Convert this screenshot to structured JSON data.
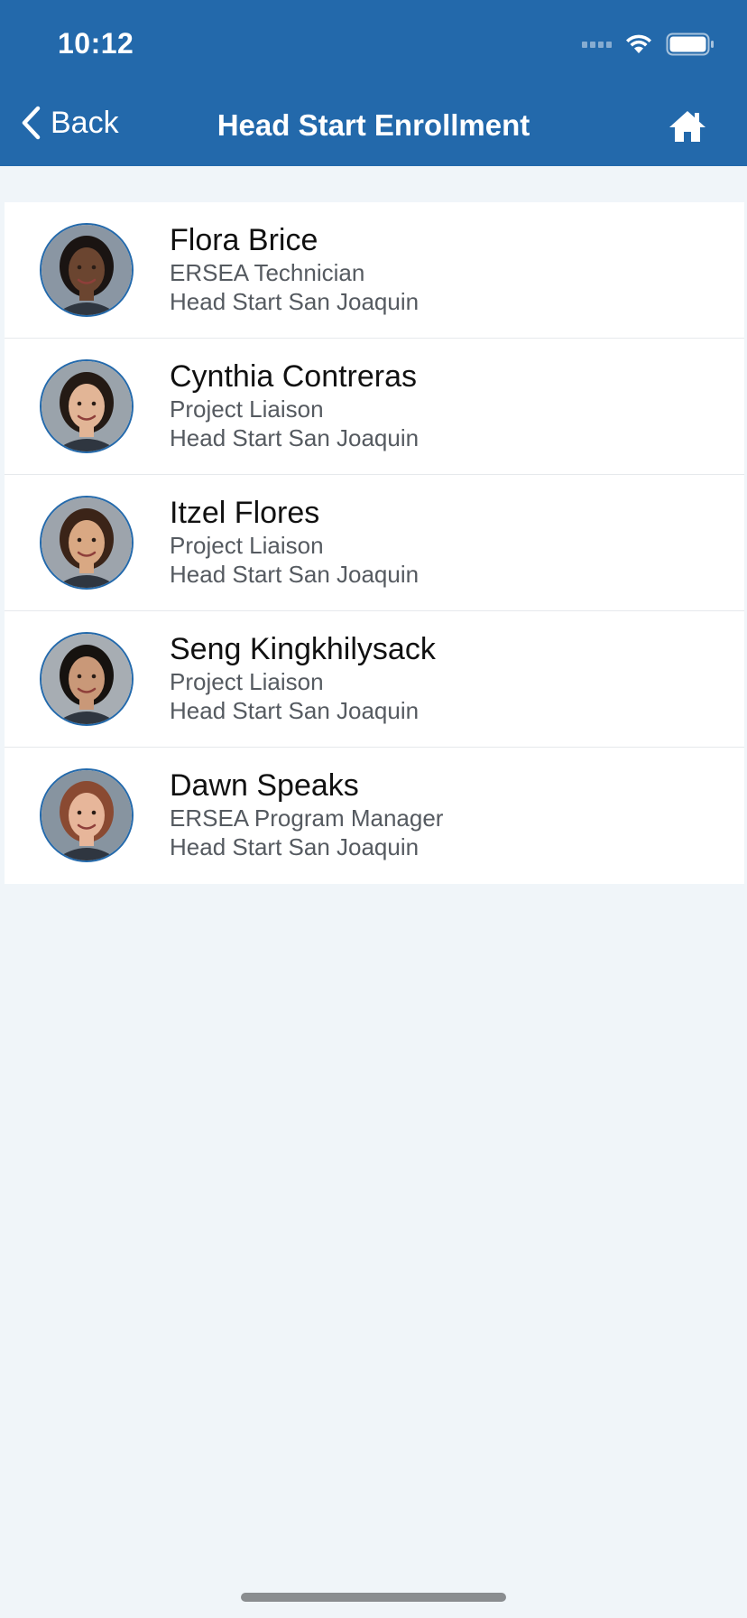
{
  "status_bar": {
    "time": "10:12"
  },
  "nav": {
    "back_label": "Back",
    "title": "Head Start Enrollment",
    "home_icon": "home-icon"
  },
  "colors": {
    "header": "#2369ab",
    "background": "#f0f5f9",
    "avatar_border": "#2369ab"
  },
  "contacts": [
    {
      "name": "Flora Brice",
      "role": "ERSEA Technician",
      "org": "Head Start San Joaquin",
      "skin": "#6b4530",
      "hair": "#1a1412",
      "bg": "#8a96a3"
    },
    {
      "name": "Cynthia Contreras",
      "role": "Project Liaison",
      "org": "Head Start San Joaquin",
      "skin": "#e2b596",
      "hair": "#241a14",
      "bg": "#9aa3ab"
    },
    {
      "name": "Itzel Flores",
      "role": "Project Liaison",
      "org": "Head Start San Joaquin",
      "skin": "#d9a883",
      "hair": "#3b2418",
      "bg": "#9da4ac"
    },
    {
      "name": "Seng Kingkhilysack",
      "role": "Project Liaison",
      "org": "Head Start San Joaquin",
      "skin": "#c99878",
      "hair": "#16120f",
      "bg": "#a7adb3"
    },
    {
      "name": "Dawn Speaks",
      "role": "ERSEA Program Manager",
      "org": "Head Start San Joaquin",
      "skin": "#e7b69a",
      "hair": "#8a4a32",
      "bg": "#8794a0"
    }
  ]
}
